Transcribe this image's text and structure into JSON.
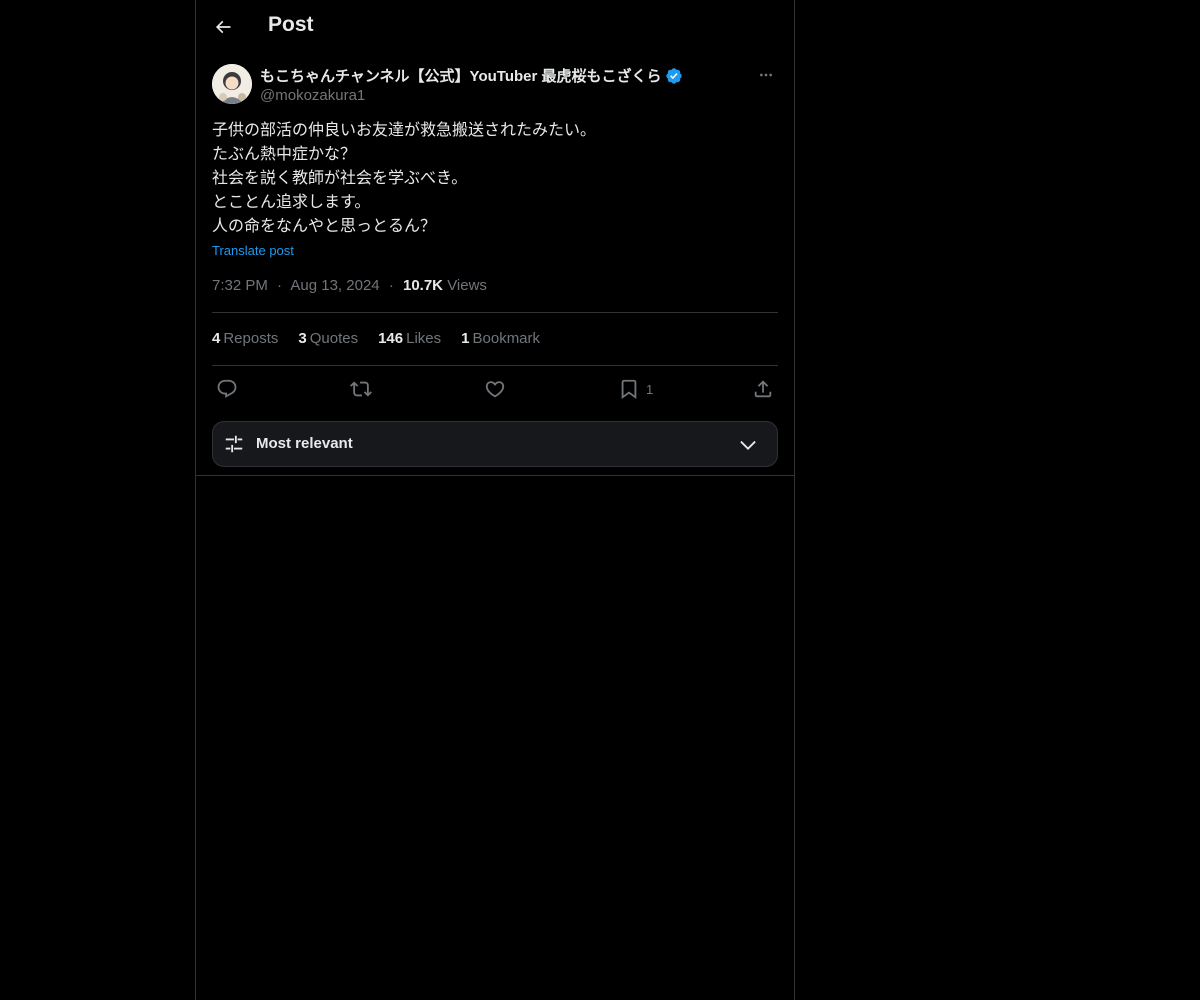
{
  "header": {
    "title": "Post"
  },
  "post": {
    "display_name": "もこちゃんチャンネル【公式】YouTuber 最虎桜もこざくら",
    "handle": "@mokozakura1",
    "text_lines": [
      "子供の部活の仲良いお友達が救急搬送されたみたい。",
      "たぶん熱中症かな？",
      "社会を説く教師が社会を学ぶべき。",
      "とことん追求します。",
      "人の命をなんやと思っとるん？"
    ],
    "translate_label": "Translate post",
    "time": "7:32 PM",
    "date": "Aug 13, 2024",
    "views_count": "10.7K",
    "views_label": "Views",
    "separator": "·"
  },
  "stats": {
    "reposts_count": "4",
    "reposts_label": "Reposts",
    "quotes_count": "3",
    "quotes_label": "Quotes",
    "likes_count": "146",
    "likes_label": "Likes",
    "bookmarks_count": "1",
    "bookmarks_label": "Bookmark"
  },
  "actions": {
    "bookmark_count": "1"
  },
  "sort": {
    "label": "Most relevant"
  },
  "colors": {
    "background": "#000000",
    "text": "#e7e9ea",
    "muted": "#71767b",
    "accent": "#1d9bf0",
    "border": "#2f3336"
  },
  "icons": {
    "back": "arrow-left-icon",
    "verified": "verified-badge-icon",
    "more": "more-horizontal-icon",
    "reply": "reply-icon",
    "repost": "repost-icon",
    "like": "heart-icon",
    "bookmark": "bookmark-icon",
    "share": "share-icon",
    "sort": "sliders-icon",
    "chevron": "chevron-down-icon"
  }
}
